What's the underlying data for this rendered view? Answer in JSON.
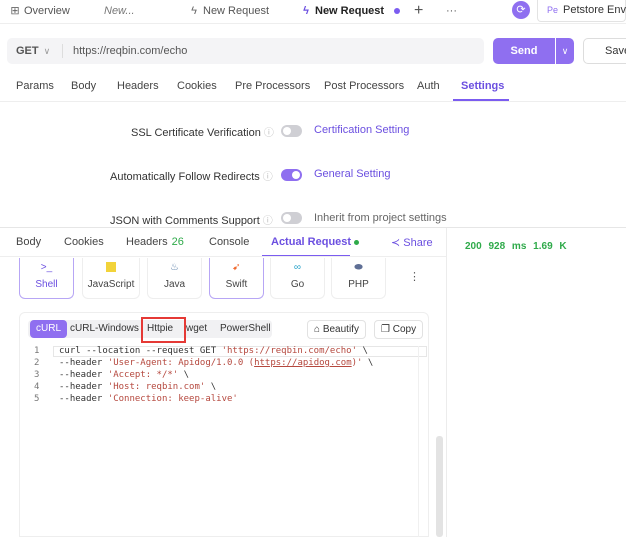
{
  "tabs": [
    {
      "label": "Overview",
      "icon": "grid-icon"
    },
    {
      "label": "New...",
      "icon": ""
    },
    {
      "label": "New Request",
      "icon": "bolt-icon"
    },
    {
      "label": "New Request",
      "icon": "bolt-icon",
      "active": true
    }
  ],
  "tabbar": {
    "add": "+",
    "more": "···",
    "env_label": "Petstore Env",
    "env_prefix": "Pe"
  },
  "request": {
    "method": "GET",
    "url": "https://reqbin.com/echo",
    "send_label": "Send",
    "save_label": "Save"
  },
  "request_tabs": [
    "Params",
    "Body",
    "Headers",
    "Cookies",
    "Pre Processors",
    "Post Processors",
    "Auth",
    "Settings"
  ],
  "settings": [
    {
      "label": "SSL Certificate Verification",
      "enabled": false,
      "link": "Certification Setting"
    },
    {
      "label": "Automatically Follow Redirects",
      "enabled": true,
      "link": "General Setting"
    },
    {
      "label": "JSON with Comments Support",
      "enabled": false,
      "link": "Inherit from project settings"
    }
  ],
  "response_tabs": [
    {
      "label": "Body"
    },
    {
      "label": "Cookies"
    },
    {
      "label": "Headers",
      "count": "26"
    },
    {
      "label": "Console"
    },
    {
      "label": "Actual Request"
    }
  ],
  "share_label": "Share",
  "status": {
    "code": "200",
    "time": "928 ms",
    "size": "1.69 K"
  },
  "languages": [
    {
      "label": "Shell",
      "icon": "shell-icon",
      "selected": true
    },
    {
      "label": "JavaScript",
      "icon": "javascript-icon"
    },
    {
      "label": "Java",
      "icon": "java-icon"
    },
    {
      "label": "Swift",
      "icon": "swift-icon",
      "selected": true
    },
    {
      "label": "Go",
      "icon": "go-icon"
    },
    {
      "label": "PHP",
      "icon": "php-icon"
    }
  ],
  "lang_more": "⋮",
  "code_tabs": [
    "cURL",
    "cURL-Windows",
    "Httpie",
    "wget",
    "PowerShell"
  ],
  "beautify_label": "Beautify",
  "copy_label": "Copy",
  "code_lines": [
    {
      "n": "1",
      "pre": "curl --location --request GET ",
      "str": "'https://reqbin.com/echo'",
      "post": " \\"
    },
    {
      "n": "2",
      "pre": "--header ",
      "str": "'User-Agent: Apidog/1.0.0 (",
      "url": "https://apidog.com",
      "str2": ")'",
      "post": " \\"
    },
    {
      "n": "3",
      "pre": "--header ",
      "str": "'Accept: */*'",
      "post": " \\"
    },
    {
      "n": "4",
      "pre": "--header ",
      "str": "'Host: reqbin.com'",
      "post": " \\"
    },
    {
      "n": "5",
      "pre": "--header ",
      "str": "'Connection: keep-alive'",
      "post": ""
    }
  ],
  "colors": {
    "accent": "#8f6ff0",
    "success": "#2faa4a",
    "highlight": "#e53935"
  }
}
